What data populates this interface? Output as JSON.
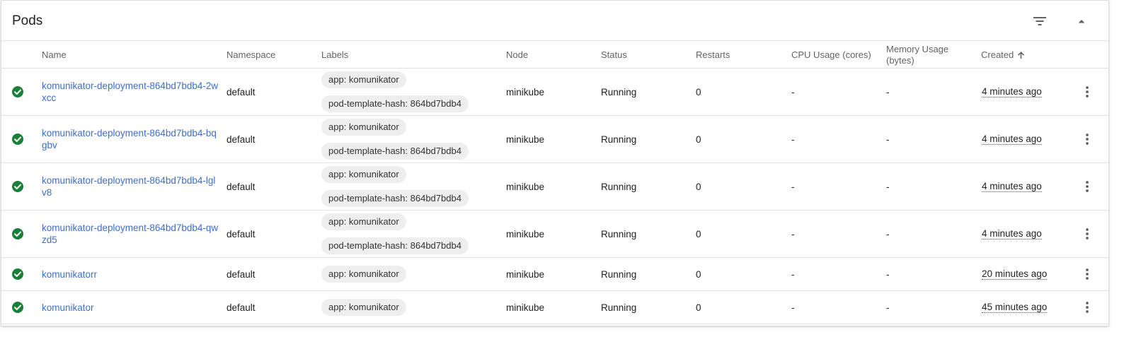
{
  "card": {
    "title": "Pods"
  },
  "columns": {
    "name": "Name",
    "namespace": "Namespace",
    "labels": "Labels",
    "node": "Node",
    "status": "Status",
    "restarts": "Restarts",
    "cpu": "CPU Usage (cores)",
    "memory": "Memory Usage (bytes)",
    "created": "Created"
  },
  "colors": {
    "accent_link": "#3f6ec9",
    "status_ok": "#188038"
  },
  "icons": {
    "filter": "filter-list-icon",
    "collapse": "arrow-drop-up-icon",
    "sort": "arrow-upward-icon",
    "status": "check-circle-icon",
    "menu": "more-vert-icon"
  },
  "rows": [
    {
      "name": "komunikator-deployment-864bd7bdb4-2wxcc",
      "namespace": "default",
      "labels": [
        "app: komunikator",
        "pod-template-hash: 864bd7bdb4"
      ],
      "node": "minikube",
      "status": "Running",
      "restarts": "0",
      "cpu": "-",
      "memory": "-",
      "created": "4 minutes ago"
    },
    {
      "name": "komunikator-deployment-864bd7bdb4-bqgbv",
      "namespace": "default",
      "labels": [
        "app: komunikator",
        "pod-template-hash: 864bd7bdb4"
      ],
      "node": "minikube",
      "status": "Running",
      "restarts": "0",
      "cpu": "-",
      "memory": "-",
      "created": "4 minutes ago"
    },
    {
      "name": "komunikator-deployment-864bd7bdb4-lglv8",
      "namespace": "default",
      "labels": [
        "app: komunikator",
        "pod-template-hash: 864bd7bdb4"
      ],
      "node": "minikube",
      "status": "Running",
      "restarts": "0",
      "cpu": "-",
      "memory": "-",
      "created": "4 minutes ago"
    },
    {
      "name": "komunikator-deployment-864bd7bdb4-qwzd5",
      "namespace": "default",
      "labels": [
        "app: komunikator",
        "pod-template-hash: 864bd7bdb4"
      ],
      "node": "minikube",
      "status": "Running",
      "restarts": "0",
      "cpu": "-",
      "memory": "-",
      "created": "4 minutes ago"
    },
    {
      "name": "komunikatorr",
      "namespace": "default",
      "labels": [
        "app: komunikator"
      ],
      "node": "minikube",
      "status": "Running",
      "restarts": "0",
      "cpu": "-",
      "memory": "-",
      "created": "20 minutes ago"
    },
    {
      "name": "komunikator",
      "namespace": "default",
      "labels": [
        "app: komunikator"
      ],
      "node": "minikube",
      "status": "Running",
      "restarts": "0",
      "cpu": "-",
      "memory": "-",
      "created": "45 minutes ago"
    }
  ]
}
